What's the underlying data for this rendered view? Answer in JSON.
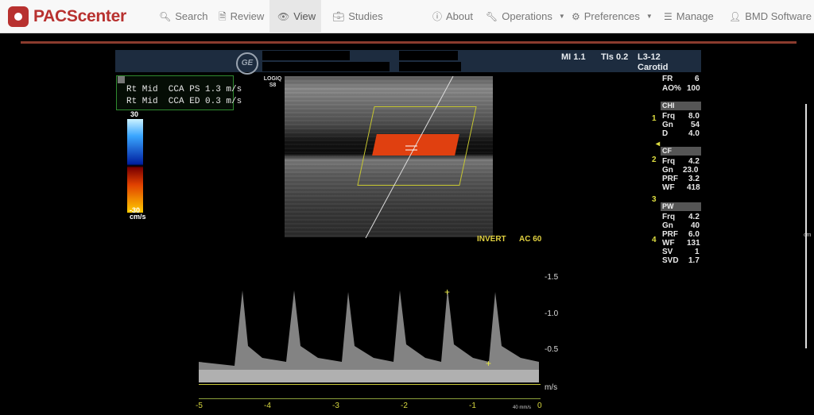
{
  "brand": {
    "name": "PACScenter"
  },
  "nav": {
    "left": [
      {
        "icon": "search-icon",
        "label": "Search"
      },
      {
        "icon": "document-icon",
        "label": "Review"
      },
      {
        "icon": "eye-icon",
        "label": "View",
        "active": true
      },
      {
        "icon": "briefcase-icon",
        "label": "Studies"
      }
    ],
    "right": [
      {
        "icon": "info-icon",
        "label": "About"
      },
      {
        "icon": "wrench-icon",
        "label": "Operations"
      },
      {
        "icon": "gears-icon",
        "label": "Preferences"
      },
      {
        "icon": "list-icon",
        "label": "Manage"
      },
      {
        "icon": "user-icon",
        "label": "BMD Software"
      }
    ]
  },
  "viewer": {
    "header": {
      "mi": "MI 1.1",
      "tis": "TIs 0.2",
      "probe": "L3-12",
      "preset": "Carotid",
      "logo": "GE"
    },
    "device": "LOGIQ S8",
    "measurements": [
      "Rt Mid  CCA PS 1.3 m/s",
      "Rt Mid  CCA ED 0.3 m/s"
    ],
    "color_scale": {
      "top": "30",
      "bottom": "-30",
      "unit": "cm/s"
    },
    "params": {
      "fr": {
        "label": "FR",
        "value": "6"
      },
      "ao": {
        "label": "AO%",
        "value": "100"
      },
      "chi": {
        "title": "CHI",
        "rows": [
          [
            "Frq",
            "8.0"
          ],
          [
            "Gn",
            "54"
          ],
          [
            "D",
            "4.0"
          ]
        ]
      },
      "cf": {
        "title": "CF",
        "rows": [
          [
            "Frq",
            "4.2"
          ],
          [
            "Gn",
            "23.0"
          ],
          [
            "PRF",
            "3.2"
          ],
          [
            "WF",
            "418"
          ]
        ]
      },
      "pw": {
        "title": "PW",
        "rows": [
          [
            "Frq",
            "4.2"
          ],
          [
            "Gn",
            "40"
          ],
          [
            "PRF",
            "6.0"
          ],
          [
            "WF",
            "131"
          ],
          [
            "SV",
            "1"
          ],
          [
            "SVD",
            "1.7"
          ]
        ]
      }
    },
    "depth_marks": [
      "1",
      "2",
      "3",
      "4"
    ],
    "ruler_unit": "cm",
    "spectral": {
      "invert": "INVERT",
      "ac": "AC 60",
      "velocity_ticks": [
        "-1.5",
        "-1.0",
        "-0.5"
      ],
      "velocity_unit": "m/s",
      "time_ticks": [
        "-5",
        "-4",
        "-3",
        "-2",
        "-1",
        "0"
      ],
      "sweep": "40 mm/s"
    }
  }
}
